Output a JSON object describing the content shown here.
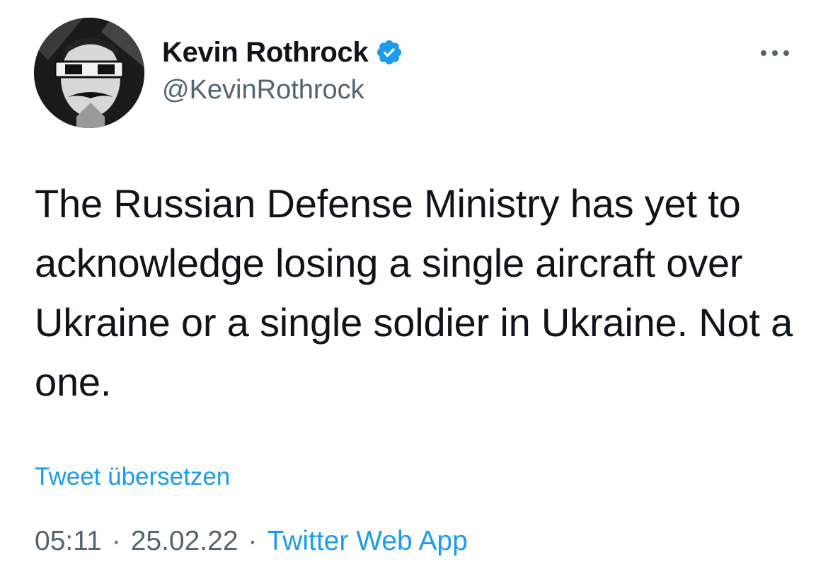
{
  "tweet": {
    "author": {
      "display_name": "Kevin Rothrock",
      "handle": "@KevinRothrock",
      "verified": true,
      "avatar_icon": "profile-photo"
    },
    "more_icon": "more-horizontal-icon",
    "text": "The Russian Defense Ministry has yet to acknowledge losing a single aircraft over Ukraine or a single soldier in Ukraine. Not a one.",
    "translate_label": "Tweet übersetzen",
    "meta": {
      "time": "05:11",
      "date": "25.02.22",
      "separator": "·",
      "source": "Twitter Web App"
    }
  },
  "colors": {
    "text": "#0f1419",
    "secondary": "#536471",
    "accent": "#1d9bf0"
  }
}
